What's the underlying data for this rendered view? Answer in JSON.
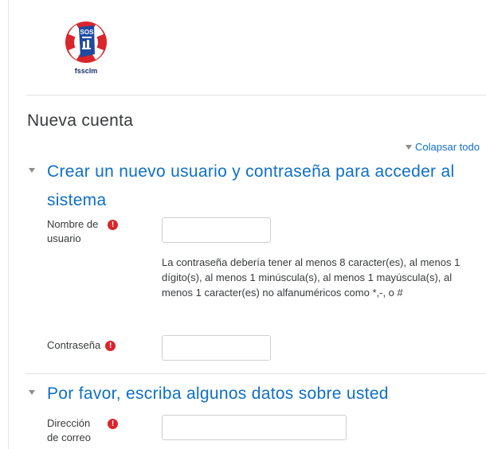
{
  "logo": {
    "text": "fssclm",
    "badge_text": "SOS",
    "colors": {
      "ring_red": "#d9262c",
      "ring_white": "#ffffff",
      "flag_blue": "#1f4aa0"
    }
  },
  "page_title": "Nueva cuenta",
  "collapse_all": "Colapsar todo",
  "sections": [
    {
      "title": "Crear un nuevo usuario y contraseña para acceder al sistema",
      "fields": {
        "username": {
          "label": "Nombre de usuario",
          "value": ""
        },
        "password_help": "La contraseña debería tener al menos 8 caracter(es), al menos 1 dígito(s), al menos 1 minúscula(s), al menos 1 mayúscula(s), al menos 1 caracter(es) no alfanuméricos como *,-, o #",
        "password": {
          "label": "Contraseña",
          "value": ""
        }
      }
    },
    {
      "title": "Por favor, escriba algunos datos sobre usted",
      "fields": {
        "email": {
          "label": "Dirección de correo",
          "value": ""
        }
      }
    }
  ],
  "colors": {
    "link": "#0f6fc5",
    "required": "#d9262c",
    "text": "#373a3c"
  },
  "icons": {
    "required": "exclamation-circle-icon",
    "collapse": "caret-down-icon"
  }
}
